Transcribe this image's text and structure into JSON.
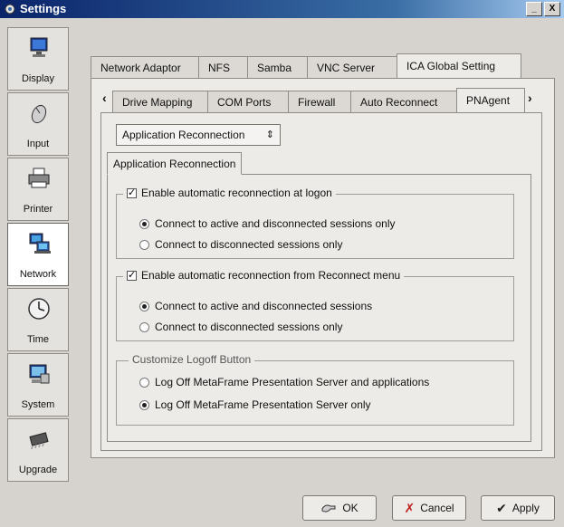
{
  "window": {
    "title": "Settings",
    "minimize_label": "_",
    "close_label": "X"
  },
  "sidebar": {
    "items": [
      {
        "label": "Display",
        "icon": "monitor-icon"
      },
      {
        "label": "Input",
        "icon": "mouse-icon"
      },
      {
        "label": "Printer",
        "icon": "printer-icon"
      },
      {
        "label": "Network",
        "icon": "network-icon",
        "active": true
      },
      {
        "label": "Time",
        "icon": "clock-icon"
      },
      {
        "label": "System",
        "icon": "system-icon"
      },
      {
        "label": "Upgrade",
        "icon": "chip-icon"
      }
    ]
  },
  "main_tabs": [
    {
      "label": "Network Adaptor"
    },
    {
      "label": "NFS"
    },
    {
      "label": "Samba"
    },
    {
      "label": "VNC Server"
    },
    {
      "label": "ICA Global Setting",
      "active": true
    }
  ],
  "sub_tabs": [
    {
      "label": "Drive Mapping"
    },
    {
      "label": "COM Ports"
    },
    {
      "label": "Firewall"
    },
    {
      "label": "Auto Reconnect"
    },
    {
      "label": "PNAgent",
      "active": true
    }
  ],
  "sub_tab_prev": "‹",
  "sub_tab_next": "›",
  "combo": {
    "value": "Application Reconnection",
    "spin": "⇕"
  },
  "inner_tab": "Application Reconnection",
  "group_logon": {
    "label": "Enable automatic reconnection at logon",
    "checked": true,
    "options": [
      {
        "label": "Connect to active and disconnected sessions only",
        "selected": true
      },
      {
        "label": "Connect to disconnected sessions only",
        "selected": false
      }
    ]
  },
  "group_menu": {
    "label": "Enable automatic reconnection from Reconnect menu",
    "checked": true,
    "options": [
      {
        "label": "Connect to active and disconnected sessions",
        "selected": true
      },
      {
        "label": "Connect to disconnected sessions only",
        "selected": false
      }
    ]
  },
  "group_logoff": {
    "label": "Customize Logoff Button",
    "options": [
      {
        "label": "Log Off MetaFrame Presentation Server and applications",
        "selected": false
      },
      {
        "label": "Log Off MetaFrame Presentation Server only",
        "selected": true
      }
    ]
  },
  "buttons": {
    "ok": "OK",
    "cancel": "Cancel",
    "apply": "Apply"
  }
}
